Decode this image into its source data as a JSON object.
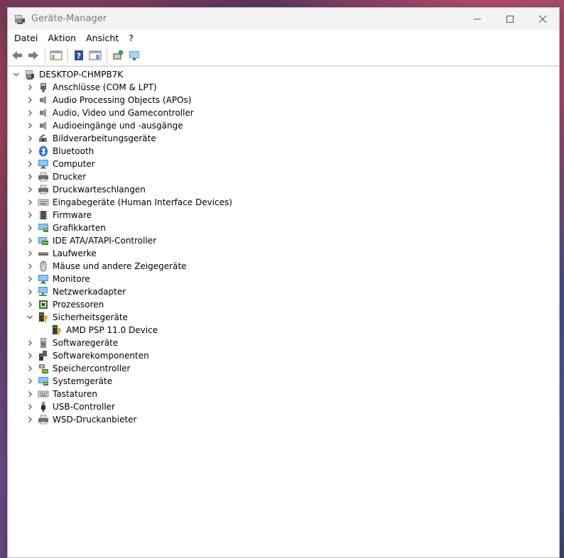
{
  "window": {
    "title": "Geräte-Manager"
  },
  "menu": [
    "Datei",
    "Aktion",
    "Ansicht",
    "?"
  ],
  "tree": {
    "root": "DESKTOP-CHMPB7K",
    "categories": [
      {
        "label": "Anschlüsse (COM & LPT)",
        "icon": "port-icon",
        "expanded": false
      },
      {
        "label": "Audio Processing Objects (APOs)",
        "icon": "speaker-icon",
        "expanded": false
      },
      {
        "label": "Audio, Video und Gamecontroller",
        "icon": "speaker-icon",
        "expanded": false
      },
      {
        "label": "Audioeingänge und -ausgänge",
        "icon": "speaker-icon",
        "expanded": false
      },
      {
        "label": "Bildverarbeitungsgeräte",
        "icon": "camera-icon",
        "expanded": false
      },
      {
        "label": "Bluetooth",
        "icon": "bluetooth-icon",
        "expanded": false
      },
      {
        "label": "Computer",
        "icon": "monitor-icon",
        "expanded": false
      },
      {
        "label": "Drucker",
        "icon": "printer-icon",
        "expanded": false
      },
      {
        "label": "Druckwarteschlangen",
        "icon": "printer-icon",
        "expanded": false
      },
      {
        "label": "Eingabegeräte (Human Interface Devices)",
        "icon": "keyboard-icon",
        "expanded": false
      },
      {
        "label": "Firmware",
        "icon": "chip-icon",
        "expanded": false
      },
      {
        "label": "Grafikkarten",
        "icon": "display-adapter-icon",
        "expanded": false
      },
      {
        "label": "IDE ATA/ATAPI-Controller",
        "icon": "controller-icon",
        "expanded": false
      },
      {
        "label": "Laufwerke",
        "icon": "drive-icon",
        "expanded": false
      },
      {
        "label": "Mäuse und andere Zeigegeräte",
        "icon": "mouse-icon",
        "expanded": false
      },
      {
        "label": "Monitore",
        "icon": "monitor-icon",
        "expanded": false
      },
      {
        "label": "Netzwerkadapter",
        "icon": "network-icon",
        "expanded": false
      },
      {
        "label": "Prozessoren",
        "icon": "processor-icon",
        "expanded": false
      },
      {
        "label": "Sicherheitsgeräte",
        "icon": "security-icon",
        "expanded": true,
        "children": [
          {
            "label": "AMD PSP 11.0 Device",
            "icon": "security-device-icon"
          }
        ]
      },
      {
        "label": "Softwaregeräte",
        "icon": "software-device-icon",
        "expanded": false
      },
      {
        "label": "Softwarekomponenten",
        "icon": "software-component-icon",
        "expanded": false
      },
      {
        "label": "Speichercontroller",
        "icon": "storage-controller-icon",
        "expanded": false
      },
      {
        "label": "Systemgeräte",
        "icon": "system-icon",
        "expanded": false
      },
      {
        "label": "Tastaturen",
        "icon": "keyboard-icon",
        "expanded": false
      },
      {
        "label": "USB-Controller",
        "icon": "usb-icon",
        "expanded": false
      },
      {
        "label": "WSD-Druckanbieter",
        "icon": "printer-icon",
        "expanded": false
      }
    ]
  }
}
